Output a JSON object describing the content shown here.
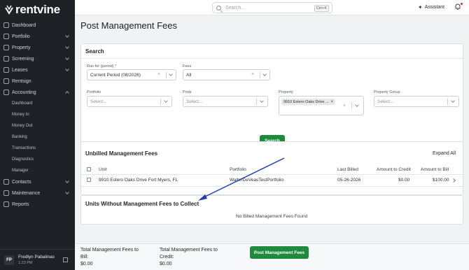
{
  "brand": {
    "name": "rentvine"
  },
  "sidebar": {
    "items": [
      {
        "label": "Dashboard",
        "icon": "grid-icon",
        "chevron": false
      },
      {
        "label": "Portfolio",
        "icon": "folder-icon",
        "chevron": true
      },
      {
        "label": "Property",
        "icon": "building-icon",
        "chevron": true
      },
      {
        "label": "Screening",
        "icon": "filter-icon",
        "chevron": true
      },
      {
        "label": "Leases",
        "icon": "lease-icon",
        "chevron": true
      },
      {
        "label": "Rentsign",
        "icon": "pen-icon",
        "chevron": false
      },
      {
        "label": "Accounting",
        "icon": "accounting-icon",
        "chevron": true,
        "expanded": true
      }
    ],
    "accounting_sub": [
      "Dashboard",
      "Money In",
      "Money Out",
      "Banking",
      "Transactions",
      "Diagnostics",
      "Manager"
    ],
    "items_after": [
      {
        "label": "Contacts",
        "icon": "contacts-icon",
        "chevron": true
      },
      {
        "label": "Maintenance",
        "icon": "wrench-icon",
        "chevron": true
      },
      {
        "label": "Reports",
        "icon": "chart-icon",
        "chevron": false
      }
    ],
    "user": {
      "initials": "FP",
      "name": "Fredlyn Pabalinas",
      "time": "1:23 PM"
    }
  },
  "topbar": {
    "search_placeholder": "Search...",
    "shortcut": "Ctrl+K",
    "assistant_label": "Assistant"
  },
  "page": {
    "title": "Post Management Fees"
  },
  "search_card": {
    "title": "Search",
    "run_for_label": "Run for (period) *",
    "run_for_value": "Current Period (08/2026)",
    "fees_label": "Fees",
    "fees_value": "All",
    "portfolio_label": "Portfolio",
    "portfolio_placeholder": "Select...",
    "pods_label": "Pods",
    "pods_placeholder": "Select...",
    "property_label": "Property",
    "property_chip": "9910 Estero Oaks Drive ...",
    "property_group_label": "Property Group",
    "property_group_placeholder": "Select...",
    "search_button": "Search"
  },
  "unbilled_card": {
    "title": "Unbilled Management Fees",
    "expand_all": "Expand All",
    "columns": [
      "Unit",
      "Portfolio",
      "Last Billed",
      "Amount to Credit",
      "Amount to Bill"
    ],
    "rows": [
      {
        "unit": "9910 Estero Oaks Drive Fort Myers, FL",
        "portfolio": "WalterDeVeasTestPortfolio",
        "last_billed": "05-26-2026",
        "credit": "$0.00",
        "bill": "$100.00"
      }
    ]
  },
  "without_card": {
    "title": "Units Without Management Fees to Collect",
    "empty": "No Billed Management Fees Found"
  },
  "footer": {
    "total_bill_label_1": "Total Management Fees to",
    "total_bill_label_2": "Bill:",
    "total_bill_value": "$0.00",
    "total_credit_label_1": "Total Management Fees to",
    "total_credit_label_2": "Credit:",
    "total_credit_value": "$0.00",
    "post_button": "Post Management Fees"
  },
  "colors": {
    "accent_green": "#1e8a3c",
    "sidebar_bg": "#1e2226",
    "annotation_arrow": "#1f3bb3"
  }
}
